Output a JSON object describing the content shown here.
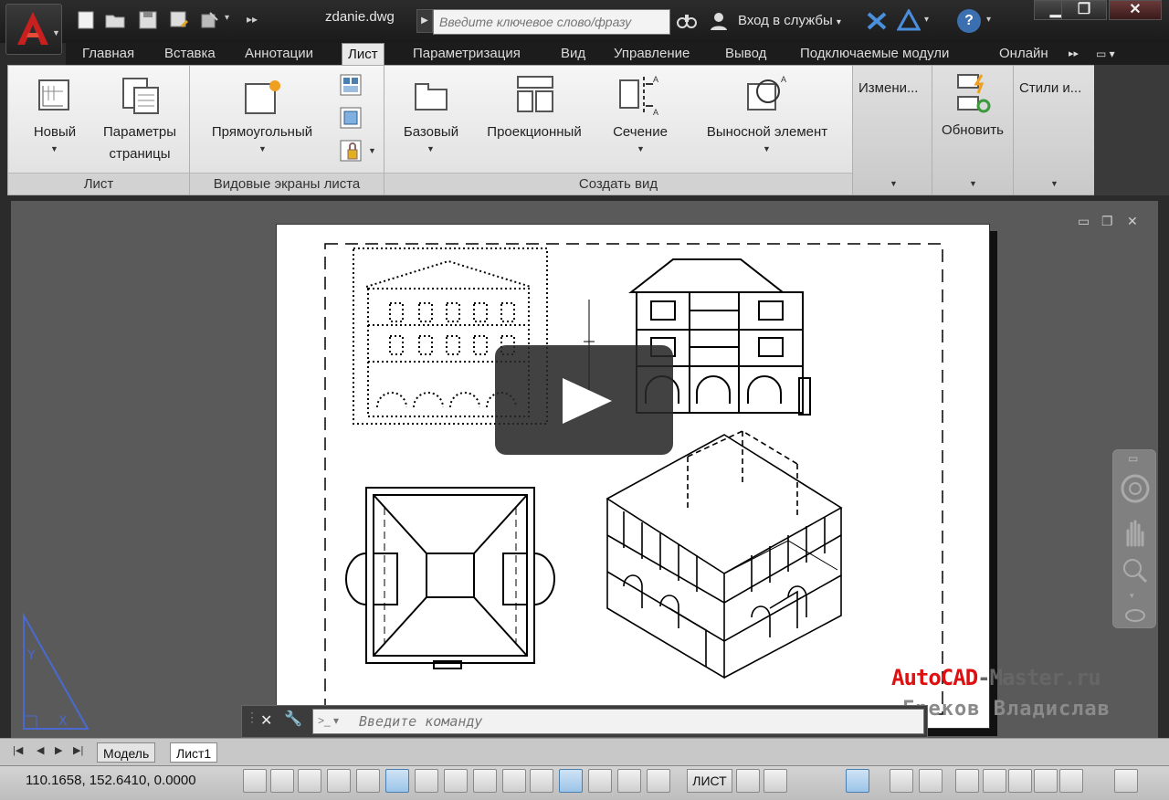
{
  "titlebar": {
    "document_title": "zdanie.dwg",
    "search_placeholder": "Введите ключевое слово/фразу",
    "signin_label": "Вход в службы",
    "signin_arrow": "▾",
    "help_label": "?",
    "window_minimize": "▁",
    "window_restore": "❐",
    "window_close": "✕"
  },
  "tabs": [
    {
      "label": "Главная"
    },
    {
      "label": "Вставка"
    },
    {
      "label": "Аннотации"
    },
    {
      "label": "Лист",
      "active": true
    },
    {
      "label": "Параметризация"
    },
    {
      "label": "Вид"
    },
    {
      "label": "Управление"
    },
    {
      "label": "Вывод"
    },
    {
      "label": "Подключаемые модули"
    },
    {
      "label": "Онлайн"
    }
  ],
  "ribbon": {
    "panel_layout": {
      "title": "Лист",
      "new_label": "Новый",
      "page_setup_label_1": "Параметры",
      "page_setup_label_2": "страницы"
    },
    "panel_viewports": {
      "title": "Видовые экраны листа",
      "rect_label": "Прямоугольный"
    },
    "panel_create_view": {
      "title": "Создать вид",
      "base_label": "Базовый",
      "projected_label": "Проекционный",
      "section_label": "Сечение",
      "detail_label": "Выносной элемент"
    },
    "panel_modify": {
      "label": "Измени..."
    },
    "panel_update": {
      "label": "Обновить"
    },
    "panel_styles": {
      "label": "Стили и..."
    }
  },
  "watermark": {
    "line1_a": "AutoCAD",
    "line1_b": "-Master.ru",
    "line2": "Греков Владислав"
  },
  "commandline": {
    "placeholder": "Введите команду",
    "close": "✕",
    "wrench": "🔧",
    "prompt": ">_ ▾"
  },
  "layout_tabs": {
    "model": "Модель",
    "sheet1": "Лист1",
    "nav": [
      "|◀",
      "◀",
      "▶",
      "▶|"
    ]
  },
  "statusbar": {
    "coordinates": "110.1658, 152.6410, 0.0000",
    "layout_label": "ЛИСТ"
  },
  "colors": {
    "accent": "#4a7fb0",
    "app_red": "#c8201e",
    "watermark_red": "#d11111",
    "ribbon_bg": "#e9e9e9",
    "canvas_bg": "#5a5a5a"
  }
}
